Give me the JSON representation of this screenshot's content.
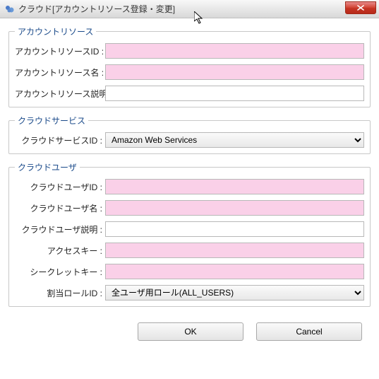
{
  "window": {
    "title": "クラウド[アカウントリソース登録・変更]"
  },
  "sections": {
    "account_resource": {
      "legend": "アカウントリソース",
      "id_label": "アカウントリソースID :",
      "id_value": "",
      "name_label": "アカウントリソース名 :",
      "name_value": "",
      "desc_label": "アカウントリソース説明 :",
      "desc_value": ""
    },
    "cloud_service": {
      "legend": "クラウドサービス",
      "service_id_label": "クラウドサービスID :",
      "service_id_value": "Amazon Web Services"
    },
    "cloud_user": {
      "legend": "クラウドユーザ",
      "user_id_label": "クラウドユーザID :",
      "user_id_value": "",
      "user_name_label": "クラウドユーザ名 :",
      "user_name_value": "",
      "user_desc_label": "クラウドユーザ説明 :",
      "user_desc_value": "",
      "access_key_label": "アクセスキー :",
      "access_key_value": "",
      "secret_key_label": "シークレットキー :",
      "secret_key_value": "",
      "role_id_label": "割当ロールID :",
      "role_id_value": "全ユーザ用ロール(ALL_USERS)"
    }
  },
  "buttons": {
    "ok": "OK",
    "cancel": "Cancel"
  },
  "colors": {
    "required_bg": "#fad0e8",
    "legend_color": "#1a4a8a"
  }
}
